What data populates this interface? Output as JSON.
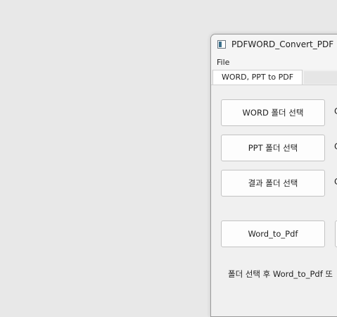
{
  "window": {
    "title": "PDFWORD_Convert_PDF",
    "icon": "app-window-icon"
  },
  "menu": {
    "items": [
      "File"
    ]
  },
  "tabs": [
    {
      "label": "WORD, PPT to PDF"
    }
  ],
  "buttons": {
    "word_folder": "WORD 폴더 선택",
    "ppt_folder": "PPT 폴더 선택",
    "result_folder": "결과 폴더 선택",
    "word_to_pdf": "Word_to_Pdf"
  },
  "side_labels": [
    "C",
    "C",
    "C"
  ],
  "info_text": "폴더 선택 후 Word_to_Pdf 또"
}
